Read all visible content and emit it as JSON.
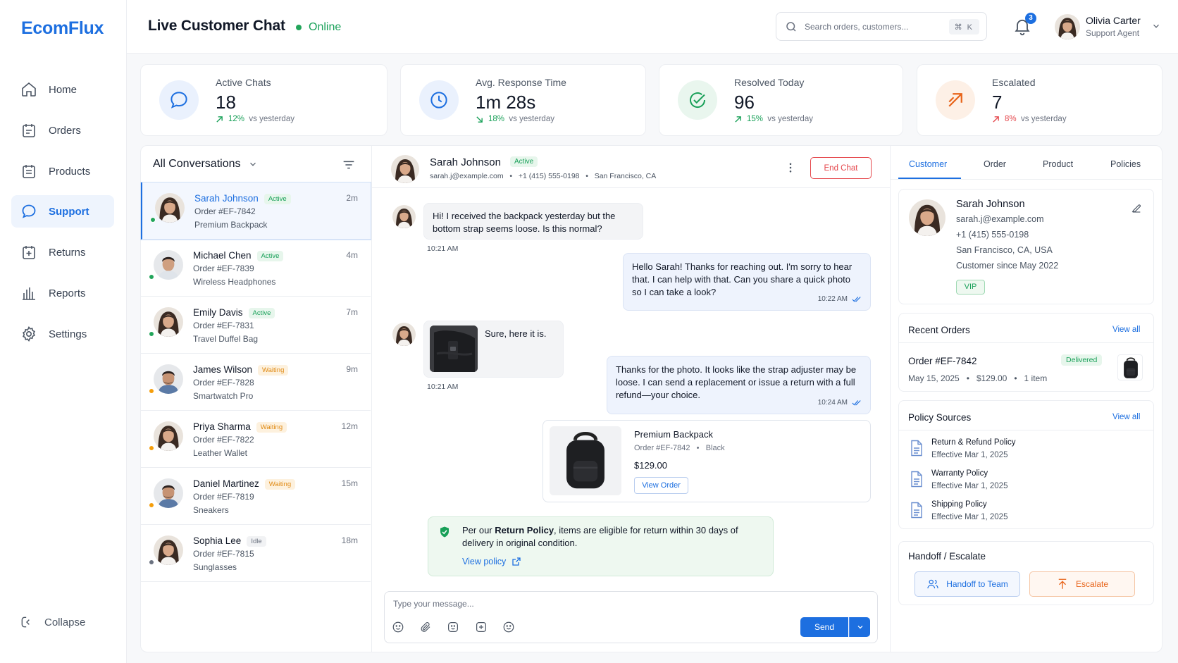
{
  "brand": {
    "name": "EcomFlux",
    "color": "#1d6fe0"
  },
  "sidebar": {
    "items": [
      {
        "label": "Home",
        "icon": "home-icon"
      },
      {
        "label": "Orders",
        "icon": "orders-icon"
      },
      {
        "label": "Products",
        "icon": "products-icon"
      },
      {
        "label": "Support",
        "icon": "chat-icon",
        "active": true
      },
      {
        "label": "Returns",
        "icon": "returns-icon"
      },
      {
        "label": "Reports",
        "icon": "bar-chart-icon"
      },
      {
        "label": "Settings",
        "icon": "gear-icon"
      }
    ],
    "collapse_label": "Collapse"
  },
  "header": {
    "title": "Live Customer Chat",
    "status": "Online",
    "search_placeholder": "Search orders, customers...",
    "shortcut": "⌘ K",
    "notifications": "3",
    "user": {
      "name": "Olivia Carter",
      "role": "Support Agent"
    }
  },
  "stats": [
    {
      "label": "Active Chats",
      "value": "18",
      "change": "12%",
      "suffix": "vs yesterday",
      "direction": "up",
      "color": "#1d6fe0"
    },
    {
      "label": "Avg. Response Time",
      "value": "1m 28s",
      "change": "18%",
      "suffix": "vs yesterday",
      "direction": "down",
      "color": "#1d6fe0"
    },
    {
      "label": "Resolved Today",
      "value": "96",
      "change": "15%",
      "suffix": "vs yesterday",
      "direction": "up",
      "color": "#18a058"
    },
    {
      "label": "Escalated",
      "value": "7",
      "change": "8%",
      "suffix": "vs yesterday",
      "direction": "up",
      "color": "#e8641a"
    }
  ],
  "conversations": {
    "title": "All Conversations",
    "items": [
      {
        "name": "Sarah Johnson",
        "status": "Active",
        "order": "Order #EF-7842",
        "product": "Premium Backpack",
        "time": "2m",
        "presence": "online"
      },
      {
        "name": "Michael Chen",
        "status": "Active",
        "order": "Order #EF-7839",
        "product": "Wireless Headphones",
        "time": "4m",
        "presence": "online"
      },
      {
        "name": "Emily Davis",
        "status": "Active",
        "order": "Order #EF-7831",
        "product": "Travel Duffel Bag",
        "time": "7m",
        "presence": "online"
      },
      {
        "name": "James Wilson",
        "status": "Waiting",
        "order": "Order #EF-7828",
        "product": "Smartwatch Pro",
        "time": "9m",
        "presence": "away"
      },
      {
        "name": "Priya Sharma",
        "status": "Waiting",
        "order": "Order #EF-7822",
        "product": "Leather Wallet",
        "time": "12m",
        "presence": "away"
      },
      {
        "name": "Daniel Martinez",
        "status": "Waiting",
        "order": "Order #EF-7819",
        "product": "Sneakers",
        "time": "15m",
        "presence": "away"
      },
      {
        "name": "Sophia Lee",
        "status": "Idle",
        "order": "Order #EF-7815",
        "product": "Sunglasses",
        "time": "18m",
        "presence": "idle"
      }
    ]
  },
  "chat": {
    "name": "Sarah Johnson",
    "status": "Active",
    "email": "sarah.j@example.com",
    "phone": "+1 (415) 555-0198",
    "location": "San Francisco, CA",
    "end_label": "End Chat",
    "messages": {
      "m1": {
        "text": "Hi! I received the backpack yesterday but the bottom strap seems loose. Is this normal?",
        "time": "10:21 AM"
      },
      "m2": {
        "text": "Hello Sarah! Thanks for reaching out. I'm sorry to hear that. I can help with that. Can you share a quick photo so I can take a look?",
        "time": "10:22 AM"
      },
      "m3": {
        "text": "Sure, here it is.",
        "time": "10:21 AM"
      },
      "m4": {
        "text": "Thanks for the photo. It looks like the strap adjuster may be loose. I can send a replacement or issue a return with a full refund—your choice.",
        "time": "10:24 AM"
      }
    },
    "product_card": {
      "name": "Premium Backpack",
      "order": "Order #EF-7842",
      "color": "Black",
      "price": "$129.00",
      "button": "View Order"
    },
    "policy_note": {
      "before": "Per our ",
      "bold": "Return Policy",
      "after": ", items are eligible for return within 30 days of delivery in original condition.",
      "link": "View policy"
    },
    "composer_placeholder": "Type your message...",
    "send_label": "Send"
  },
  "details": {
    "tabs": [
      "Customer",
      "Order",
      "Product",
      "Policies"
    ],
    "customer": {
      "name": "Sarah Johnson",
      "email": "sarah.j@example.com",
      "phone": "+1 (415) 555-0198",
      "address": "San Francisco, CA, USA",
      "since": "Customer since May 2022",
      "tag": "VIP"
    },
    "recent_orders": {
      "title": "Recent Orders",
      "link": "View all",
      "order": "Order #EF-7842",
      "status": "Delivered",
      "date": "May 15, 2025",
      "amount": "$129.00",
      "items": "1 item"
    },
    "policy_sources": {
      "title": "Policy Sources",
      "link": "View all",
      "items": [
        {
          "name": "Return & Refund Policy",
          "effective": "Effective Mar 1, 2025"
        },
        {
          "name": "Warranty Policy",
          "effective": "Effective Mar 1, 2025"
        },
        {
          "name": "Shipping Policy",
          "effective": "Effective Mar 1, 2025"
        }
      ]
    },
    "handoff": {
      "title": "Handoff / Escalate",
      "handoff_label": "Handoff to Team",
      "escalate_label": "Escalate"
    }
  }
}
